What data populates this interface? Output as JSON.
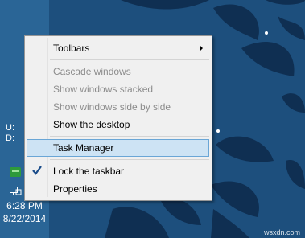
{
  "colors": {
    "desktop_bg": "#1d4f7d",
    "taskbar_bg": "#2a6596",
    "menu_bg": "#f0f0f0",
    "highlight_bg": "#cde3f4",
    "highlight_border": "#6aa6d6"
  },
  "tray": {
    "drive_u": "U:",
    "drive_d": "D:",
    "icons": [
      "green-chat-icon",
      "network-icon"
    ],
    "clock_time": "6:28 PM",
    "clock_date": "8/22/2014"
  },
  "context_menu": {
    "items": [
      {
        "label": "Toolbars",
        "enabled": true,
        "submenu": true
      },
      {
        "label": "Cascade windows",
        "enabled": false
      },
      {
        "label": "Show windows stacked",
        "enabled": false
      },
      {
        "label": "Show windows side by side",
        "enabled": false
      },
      {
        "label": "Show the desktop",
        "enabled": true
      },
      {
        "label": "Task Manager",
        "enabled": true,
        "highlighted": true
      },
      {
        "label": "Lock the taskbar",
        "enabled": true,
        "checked": true
      },
      {
        "label": "Properties",
        "enabled": true
      }
    ]
  },
  "watermark": "wsxdn.com"
}
